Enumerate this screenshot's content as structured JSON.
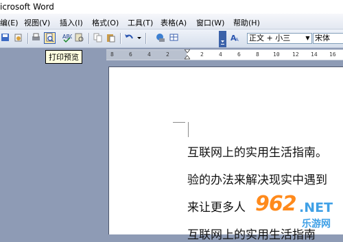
{
  "window": {
    "title": "icrosoft Word"
  },
  "menu": [
    "编(E)",
    "视图(V)",
    "插入(I)",
    "格式(O)",
    "工具(T)",
    "表格(A)",
    "窗口(W)",
    "帮助(H)"
  ],
  "toolbar": {
    "style_combo": "正文 + 小三",
    "font_combo": "宋体",
    "tooltip": "打印预览"
  },
  "ruler": {
    "ticks": [
      "8",
      "6",
      "4",
      "2",
      "2",
      "4",
      "6",
      "8",
      "10",
      "12",
      "14",
      "16"
    ]
  },
  "document": {
    "lines": [
      "互联网上的实用生活指南。",
      "验的办法来解决现实中遇到",
      "来让更多人",
      "互联网上的实用生活指南"
    ]
  },
  "watermark": {
    "logo": "962",
    "net": ".NET",
    "cn": "乐游网"
  }
}
